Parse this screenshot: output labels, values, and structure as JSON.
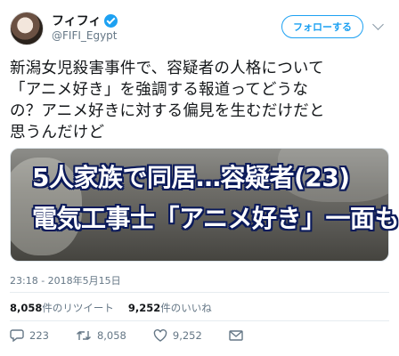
{
  "header": {
    "display_name": "フィフィ",
    "handle": "@FIFI_Egypt",
    "follow_label": "フォローする"
  },
  "tweet": {
    "text": "新潟女児殺害事件で、容疑者の人格について\n「アニメ好き」を強調する報道ってどうな\nの？アニメ好きに対する偏見を生むだけだと\n思うんだけど",
    "image_caption_line1": "5人家族で同居…容疑者(23)",
    "image_caption_line2": "電気工事士「アニメ好き」一面も",
    "timestamp": "23:18 - 2018年5月15日"
  },
  "stats": {
    "retweets_count": "8,058",
    "retweets_label": "件のリツイート",
    "likes_count": "9,252",
    "likes_label": "件のいいね"
  },
  "actions": {
    "replies": "223",
    "retweets": "8,058",
    "likes": "9,252"
  },
  "colors": {
    "accent": "#1da1f2",
    "muted": "#657786",
    "caption_outline": "#0b1a5a"
  }
}
